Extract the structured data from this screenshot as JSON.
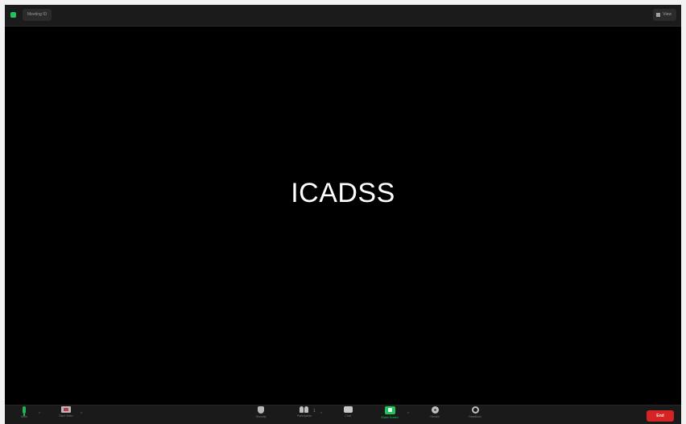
{
  "topbar": {
    "meeting_info": "Meeting ID",
    "view_label": "View"
  },
  "stage": {
    "shared_content_name": "ICADSS"
  },
  "toolbar": {
    "mute": "Mute",
    "video": "Start Video",
    "security": "Security",
    "participants": "Participants",
    "participant_count": "1",
    "chat": "Chat",
    "share": "Share Screen",
    "record": "Record",
    "reactions": "Reactions",
    "end": "End"
  },
  "colors": {
    "accent_green": "#23c35c",
    "end_red": "#d62424",
    "video_off_red": "#c8344a"
  }
}
